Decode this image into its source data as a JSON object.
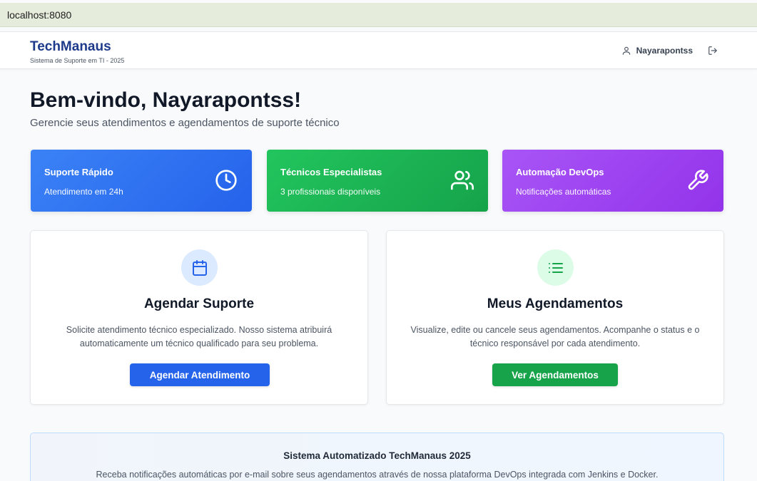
{
  "browser": {
    "url": "localhost:8080"
  },
  "header": {
    "brand_title": "TechManaus",
    "brand_subtitle": "Sistema de Suporte em TI - 2025",
    "username": "Nayarapontss"
  },
  "welcome": {
    "title": "Bem-vindo, Nayarapontss!",
    "subtitle": "Gerencie seus atendimentos e agendamentos de suporte técnico"
  },
  "features": [
    {
      "title": "Suporte Rápido",
      "subtitle": "Atendimento em 24h",
      "icon": "clock-icon",
      "color": "#3b82f6"
    },
    {
      "title": "Técnicos Especialistas",
      "subtitle": "3 profissionais disponíveis",
      "icon": "users-icon",
      "color": "#22c55e"
    },
    {
      "title": "Automação DevOps",
      "subtitle": "Notificações automáticas",
      "icon": "wrench-icon",
      "color": "#a855f7"
    }
  ],
  "cards": [
    {
      "title": "Agendar Suporte",
      "description": "Solicite atendimento técnico especializado. Nosso sistema atribuirá automaticamente um técnico qualificado para seu problema.",
      "button": "Agendar Atendimento",
      "icon": "calendar-icon",
      "color": "#2563eb"
    },
    {
      "title": "Meus Agendamentos",
      "description": "Visualize, edite ou cancele seus agendamentos. Acompanhe o status e o técnico responsável por cada atendimento.",
      "button": "Ver Agendamentos",
      "icon": "list-icon",
      "color": "#16a34a"
    }
  ],
  "banner": {
    "title": "Sistema Automatizado TechManaus 2025",
    "description": "Receba notificações automáticas por e-mail sobre seus agendamentos através de nossa plataforma DevOps integrada com Jenkins e Docker."
  }
}
